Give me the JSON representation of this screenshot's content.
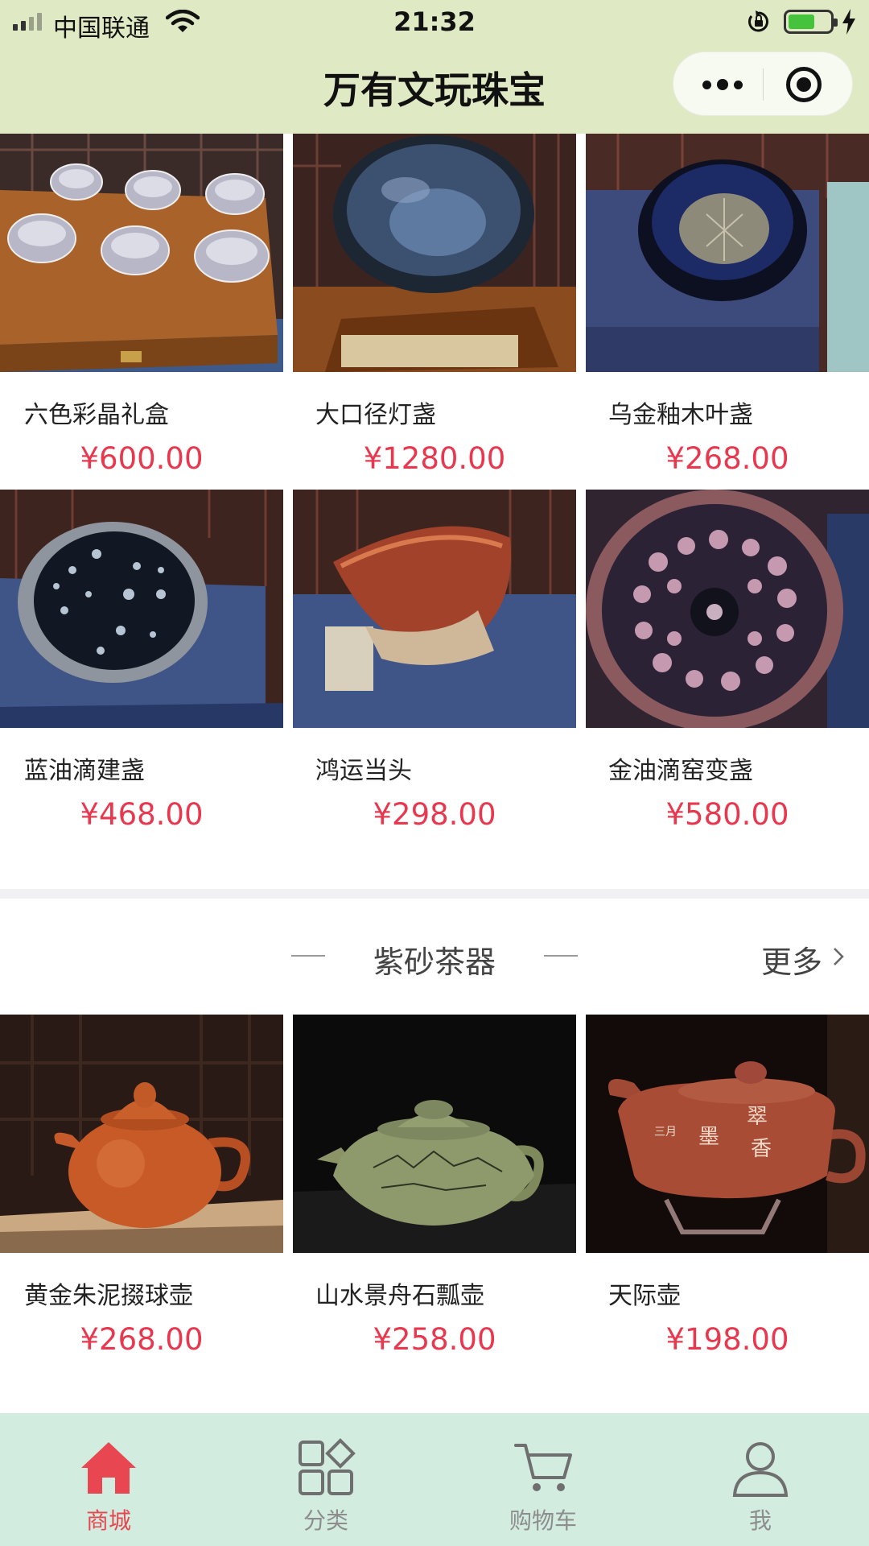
{
  "status_bar": {
    "carrier": "中国联通",
    "time": "21:32",
    "battery_level": 0.55
  },
  "header": {
    "title": "万有文玩珠宝"
  },
  "products_section_1": [
    {
      "name": "六色彩晶礼盒",
      "price": "¥600.00",
      "image": "six-silver-cups-gift-box"
    },
    {
      "name": "大口径灯盏",
      "price": "¥1280.00",
      "image": "wide-blue-lamp-bowl"
    },
    {
      "name": "乌金釉木叶盏",
      "price": "¥268.00",
      "image": "black-glaze-leaf-bowl"
    },
    {
      "name": "蓝油滴建盏",
      "price": "¥468.00",
      "image": "blue-oil-spot-bowl"
    },
    {
      "name": "鸿运当头",
      "price": "¥298.00",
      "image": "red-glaze-bowl"
    },
    {
      "name": "金油滴窑变盏",
      "price": "¥580.00",
      "image": "golden-oil-spot-bowl"
    }
  ],
  "section_2": {
    "title": "紫砂茶器",
    "more_label": "更多",
    "products": [
      {
        "name": "黄金朱泥掇球壶",
        "price": "¥268.00",
        "image": "orange-clay-teapot"
      },
      {
        "name": "山水景舟石瓢壶",
        "price": "¥258.00",
        "image": "green-clay-landscape-teapot"
      },
      {
        "name": "天际壶",
        "price": "¥198.00",
        "image": "calligraphy-clay-teapot"
      }
    ]
  },
  "tabbar": {
    "items": [
      {
        "label": "商城",
        "icon": "home-icon",
        "active": true
      },
      {
        "label": "分类",
        "icon": "category-icon",
        "active": false
      },
      {
        "label": "购物车",
        "icon": "cart-icon",
        "active": false
      },
      {
        "label": "我",
        "icon": "user-icon",
        "active": false
      }
    ]
  },
  "colors": {
    "header_bg": "#dfe9c3",
    "price": "#e8384f",
    "tabbar_bg": "#d2ece0",
    "tab_active": "#e84650",
    "tab_inactive": "#8d8d8d"
  }
}
